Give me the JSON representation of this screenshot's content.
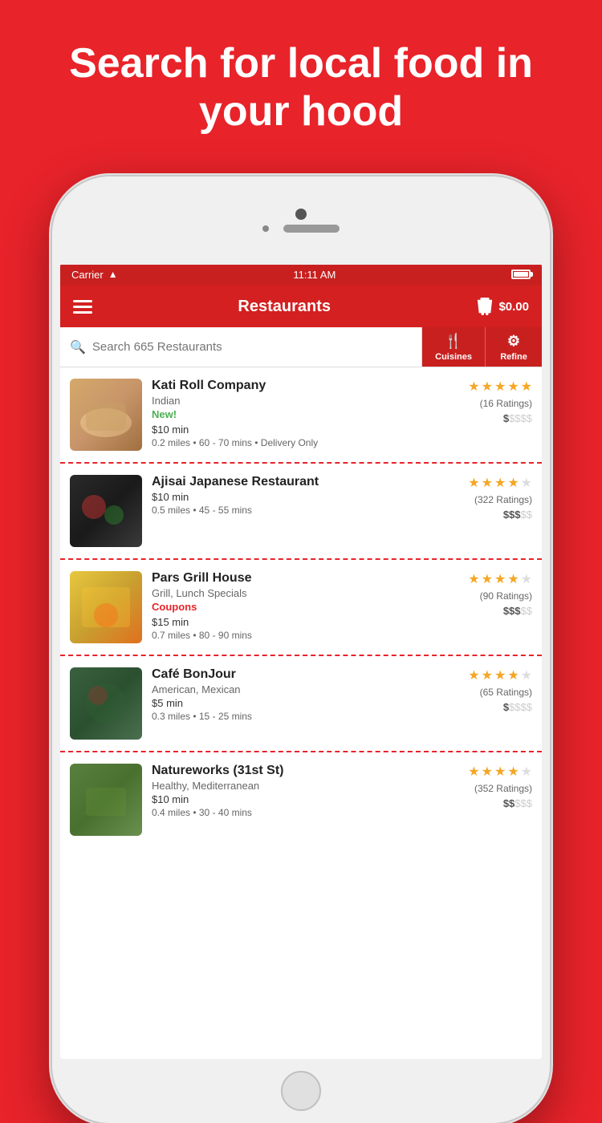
{
  "hero": {
    "title": "Search for local food in your hood"
  },
  "status_bar": {
    "carrier": "Carrier",
    "time": "11:11 AM"
  },
  "nav": {
    "title": "Restaurants",
    "cart_amount": "$0.00"
  },
  "search": {
    "placeholder": "Search 665 Restaurants"
  },
  "filters": {
    "cuisines_label": "Cuisines",
    "refine_label": "Refine"
  },
  "restaurants": [
    {
      "name": "Kati Roll Company",
      "cuisine": "Indian",
      "tag": "New!",
      "tag_type": "new",
      "min_order": "$10 min",
      "details": "0.2 miles • 60 - 70 mins • Delivery Only",
      "stars": 5,
      "max_stars": 5,
      "ratings": "(16 Ratings)",
      "price_active": "$",
      "price_inactive": "$$$$",
      "img_class": "food-img-1"
    },
    {
      "name": "Ajisai Japanese Restaurant",
      "cuisine": "",
      "tag": "",
      "tag_type": "",
      "min_order": "$10 min",
      "details": "0.5 miles • 45 - 55 mins",
      "stars": 4,
      "max_stars": 5,
      "ratings": "(322 Ratings)",
      "price_active": "$$$",
      "price_inactive": "$$",
      "img_class": "food-img-2"
    },
    {
      "name": "Pars Grill House",
      "cuisine": "Grill, Lunch Specials",
      "tag": "Coupons",
      "tag_type": "coupon",
      "min_order": "$15 min",
      "details": "0.7 miles • 80 - 90 mins",
      "stars": 4,
      "max_stars": 5,
      "ratings": "(90 Ratings)",
      "price_active": "$$$",
      "price_inactive": "$$",
      "img_class": "food-img-3"
    },
    {
      "name": "Café BonJour",
      "cuisine": "American, Mexican",
      "tag": "",
      "tag_type": "",
      "min_order": "$5 min",
      "details": "0.3 miles • 15 - 25 mins",
      "stars": 4,
      "max_stars": 5,
      "ratings": "(65 Ratings)",
      "price_active": "$",
      "price_inactive": "$$$$",
      "img_class": "food-img-4"
    },
    {
      "name": "Natureworks (31st St)",
      "cuisine": "Healthy, Mediterranean",
      "tag": "",
      "tag_type": "",
      "min_order": "$10 min",
      "details": "0.4 miles • 30 - 40 mins",
      "stars": 4,
      "max_stars": 5,
      "ratings": "(352 Ratings)",
      "price_active": "$$",
      "price_inactive": "$$$",
      "img_class": "food-img-5"
    }
  ]
}
